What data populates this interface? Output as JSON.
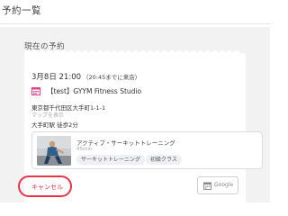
{
  "page": {
    "title": "予約一覧"
  },
  "section": {
    "heading": "現在の予約"
  },
  "reservation": {
    "date": "3月8日 21:00",
    "deadline": "（20:45までに来店）",
    "studio": "【test】GYYM Fitness Studio",
    "address": "東京都千代田区大手町1-1-1",
    "map_link": "マップを表示",
    "station": "大手町駅 徒歩2分"
  },
  "program": {
    "name": "アクティブ・サーキットトレーニング",
    "duration": "45min",
    "tags": [
      "サーキットトレーニング",
      "初級クラス"
    ]
  },
  "actions": {
    "cancel_label": "キャンセル",
    "google_label": "Google"
  },
  "colors": {
    "accent": "#e8344a",
    "calendar_icon": "#e83e8c",
    "panel_bg": "#f2f2f2"
  },
  "icons": {
    "studio": "calendar-icon",
    "google": "calendar-icon"
  }
}
